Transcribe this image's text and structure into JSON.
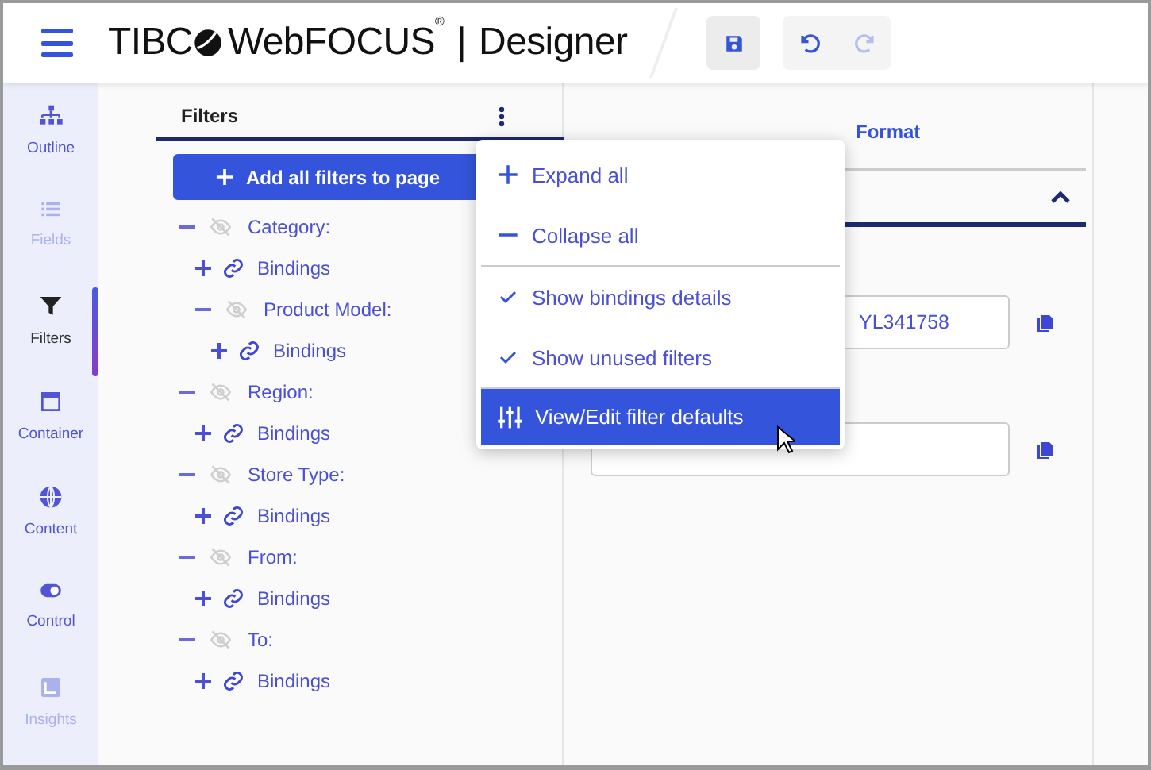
{
  "header": {
    "logo": {
      "brand": "TIBC",
      "product": "WebFOCUS$^{®}$",
      "separator": "|",
      "app": "Designer"
    },
    "toolbar": [
      {
        "kind": "save",
        "disabled": false
      },
      {
        "kind": "undo",
        "disabled": false
      },
      {
        "kind": "redo",
        "disabled": true
      }
    ]
  },
  "rail": [
    {
      "kind": "outline",
      "label": "Outline",
      "selected": false,
      "disabled": false
    },
    {
      "kind": "fields",
      "label": "Fields",
      "selected": false,
      "disabled": true
    },
    {
      "kind": "filters",
      "label": "Filters",
      "selected": true,
      "disabled": false
    },
    {
      "kind": "container",
      "label": "Container",
      "selected": false,
      "disabled": false
    },
    {
      "kind": "content",
      "label": "Content",
      "selected": false,
      "disabled": false
    },
    {
      "kind": "control",
      "label": "Control",
      "selected": false,
      "disabled": false
    },
    {
      "kind": "insights",
      "label": "Insights",
      "selected": false,
      "disabled": true
    }
  ],
  "filters_panel": {
    "title": "Filters",
    "add_button": "Add all filters to page",
    "tree": [
      {
        "kind": "filter",
        "label": "Category:",
        "expanded": true,
        "children": [
          {
            "kind": "bindings",
            "label": "Bindings",
            "expanded": false
          },
          {
            "kind": "filter",
            "label": "Product Model:",
            "expanded": true,
            "children": [
              {
                "kind": "bindings",
                "label": "Bindings",
                "expanded": false
              }
            ]
          }
        ]
      },
      {
        "kind": "filter",
        "label": "Region:",
        "expanded": true,
        "children": [
          {
            "kind": "bindings",
            "label": "Bindings",
            "expanded": false
          }
        ]
      },
      {
        "kind": "filter",
        "label": "Store Type:",
        "expanded": true,
        "children": [
          {
            "kind": "bindings",
            "label": "Bindings",
            "expanded": false
          }
        ]
      },
      {
        "kind": "filter",
        "label": "From:",
        "expanded": true,
        "children": [
          {
            "kind": "bindings",
            "label": "Bindings",
            "expanded": false
          }
        ]
      },
      {
        "kind": "filter",
        "label": "To:",
        "expanded": true,
        "children": [
          {
            "kind": "bindings",
            "label": "Bindings",
            "expanded": false
          }
        ]
      }
    ]
  },
  "menu": [
    {
      "kind": "expand",
      "label": "Expand all",
      "highlighted": false
    },
    {
      "kind": "collapse",
      "label": "Collapse all",
      "highlighted": false
    },
    {
      "kind": "divider"
    },
    {
      "kind": "toggle",
      "label": "Show bindings details",
      "checked": true,
      "highlighted": false
    },
    {
      "kind": "toggle",
      "label": "Show unused filters",
      "checked": true,
      "highlighted": false
    },
    {
      "kind": "divider"
    },
    {
      "kind": "defaults",
      "label": "View/Edit filter defaults",
      "highlighted": true
    }
  ],
  "properties_panel": {
    "tab": "Format",
    "expanded": true,
    "fields": [
      {
        "kind": "text",
        "value": "YL341758"
      },
      {
        "kind": "text"
      }
    ]
  }
}
